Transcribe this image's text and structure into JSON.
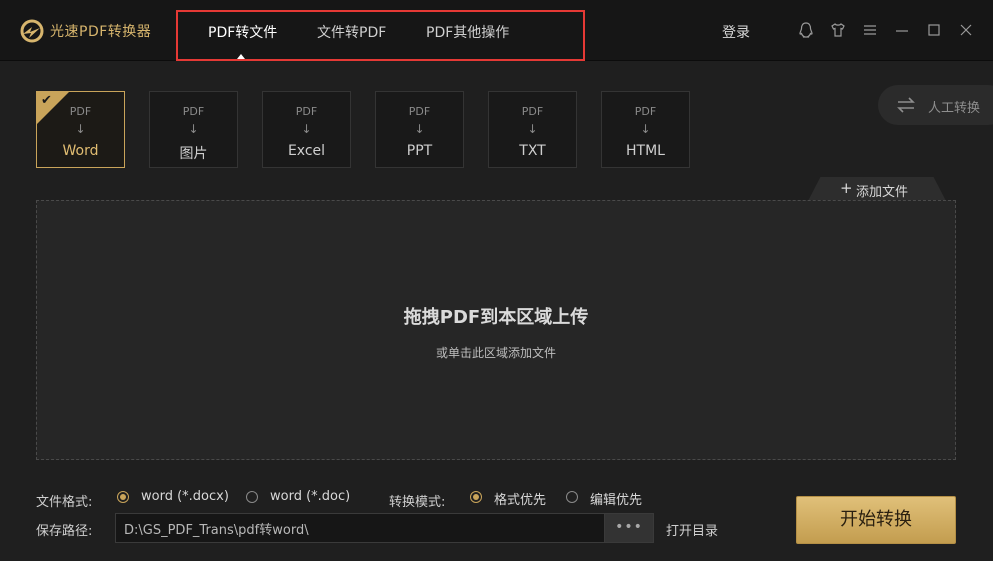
{
  "app": {
    "title": "光速PDF转换器"
  },
  "nav": {
    "tabs": [
      {
        "label": "PDF转文件",
        "active": true
      },
      {
        "label": "文件转PDF",
        "active": false
      },
      {
        "label": "PDF其他操作",
        "active": false
      }
    ]
  },
  "header": {
    "login": "登录",
    "icons": [
      "qq-icon",
      "skin-icon",
      "menu-icon",
      "minimize-icon",
      "maximize-icon",
      "close-icon"
    ]
  },
  "formats": {
    "source_label": "PDF",
    "arrow": "↓",
    "items": [
      {
        "label": "Word",
        "selected": true
      },
      {
        "label": "图片",
        "selected": false
      },
      {
        "label": "Excel",
        "selected": false
      },
      {
        "label": "PPT",
        "selected": false
      },
      {
        "label": "TXT",
        "selected": false
      },
      {
        "label": "HTML",
        "selected": false
      }
    ],
    "check": "✔"
  },
  "manual": {
    "label": "人工转换"
  },
  "add_file": {
    "plus": "+",
    "label": "添加文件"
  },
  "dropzone": {
    "title": "拖拽PDF到本区域上传",
    "subtitle": "或单击此区域添加文件"
  },
  "options": {
    "file_format_label": "文件格式:",
    "file_formats": [
      {
        "label": "word (*.docx)",
        "checked": true
      },
      {
        "label": "word (*.doc)",
        "checked": false
      }
    ],
    "mode_label": "转换模式:",
    "modes": [
      {
        "label": "格式优先",
        "checked": true
      },
      {
        "label": "编辑优先",
        "checked": false
      }
    ],
    "save_path_label": "保存路径:",
    "save_path_value": "D:\\GS_PDF_Trans\\pdf转word\\",
    "browse_label": "•••",
    "open_dir_label": "打开目录"
  },
  "start_button": {
    "label": "开始转换"
  },
  "colors": {
    "accent": "#c9a45a",
    "highlight": "#e53935",
    "background": "#1f1f1f",
    "titlebar": "#161616"
  }
}
